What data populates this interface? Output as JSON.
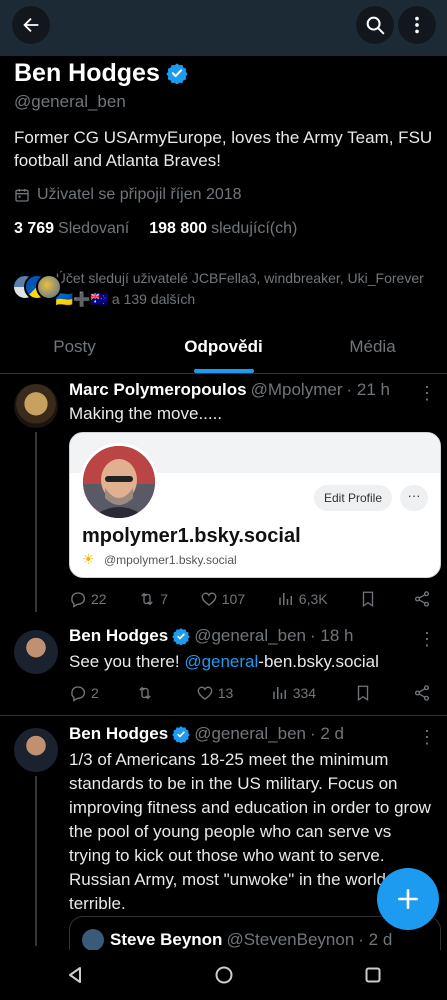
{
  "profile": {
    "display_name": "Ben Hodges",
    "handle": "@general_ben",
    "bio": "Former CG USArmyEurope, loves the Army Team, FSU football and Atlanta Braves!",
    "joined": "Uživatel se připojil říjen 2018",
    "following_count": "3 769",
    "following_label": "Sledovaní",
    "followers_count": "198 800",
    "followers_label": "sledující(ch)",
    "known_followers": "Účet sledují uživatelé JCBFella3, windbreaker, Uki_Forever 🇺🇦➕🇦🇺 a 139 dalších"
  },
  "tabs": [
    {
      "label": "Posty"
    },
    {
      "label": "Odpovědi"
    },
    {
      "label": "Média"
    }
  ],
  "posts": [
    {
      "name": "Marc Polymeropoulos",
      "handle": "@Mpolymer",
      "time": "· 21 h",
      "text": "Making the move.....",
      "card": {
        "title": "mpolymer1.bsky.social",
        "sub": "@mpolymer1.bsky.social",
        "edit": "Edit Profile",
        "more": "···"
      },
      "replies": "22",
      "reposts": "7",
      "likes": "107",
      "views": "6,3K"
    },
    {
      "name": "Ben Hodges",
      "handle": "@general_ben",
      "time": "· 18 h",
      "text_before": "See you there! ",
      "mention": "@general",
      "text_after": "-ben.bsky.social",
      "replies": "2",
      "reposts": "",
      "likes": "13",
      "views": "334"
    },
    {
      "name": "Ben Hodges",
      "handle": "@general_ben",
      "time": "· 2 d",
      "text": "1/3 of Americans 18-25 meet the minimum standards to be in the US military. Focus on improving fitness and education in order to grow the pool of young people who can serve vs trying to kick out those who want to serve. Russian Army, most \"unwoke\" in the world, is terrible.",
      "quote": {
        "name": "Steve Beynon",
        "handle": "@StevenBeynon",
        "time": "· 2 d"
      }
    }
  ],
  "colors": {
    "accent": "#1d9bf0",
    "background": "#000000",
    "muted": "#71767b",
    "header": "#1c2a36"
  },
  "icons": [
    "back-arrow-icon",
    "search-icon",
    "more-icon",
    "verified-badge-icon",
    "calendar-icon",
    "reply-icon",
    "repost-icon",
    "like-icon",
    "views-icon",
    "bookmark-icon",
    "share-icon",
    "compose-plus-icon",
    "nav-back-icon",
    "nav-home-icon",
    "nav-recents-icon"
  ]
}
